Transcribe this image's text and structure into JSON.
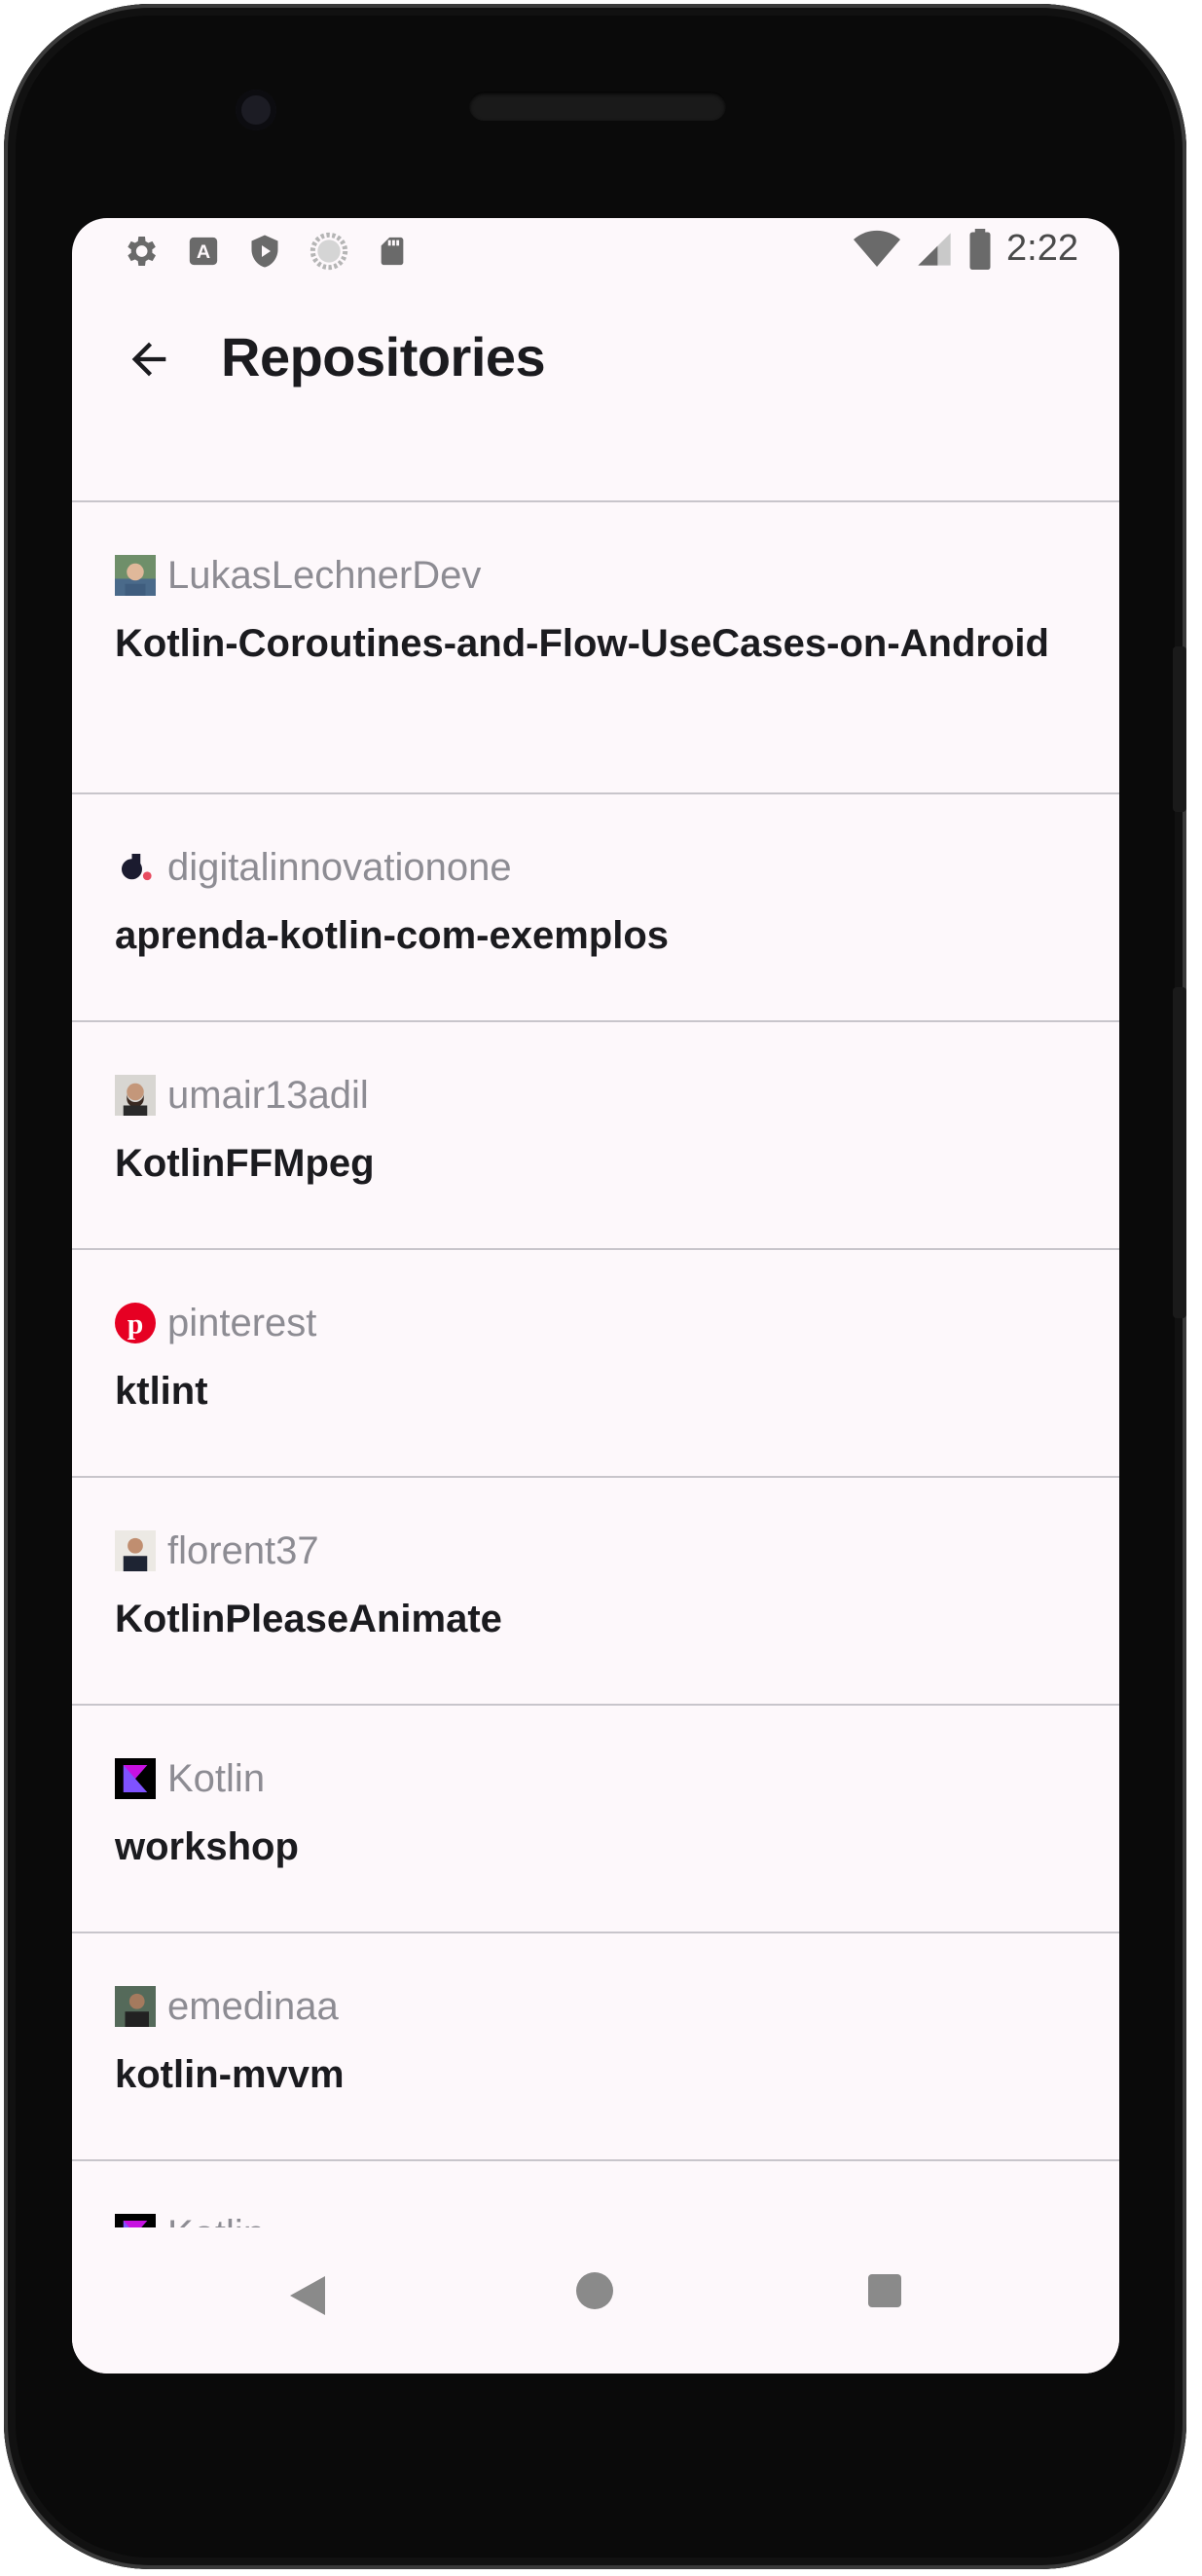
{
  "status_bar": {
    "time": "2:22",
    "left_icons": [
      "settings-icon",
      "a-badge-icon",
      "shield-play-icon",
      "loading-circle-icon",
      "sd-card-icon"
    ],
    "right_icons": [
      "wifi-icon",
      "signal-icon",
      "battery-icon"
    ]
  },
  "app_bar": {
    "title": "Repositories",
    "back_icon": "arrow-back-icon"
  },
  "repositories": [
    {
      "owner": "LukasLechnerDev",
      "name": "Kotlin-Coroutines-and-Flow-UseCases-on-Android",
      "avatar": "photo-avatar"
    },
    {
      "owner": "digitalinnovationone",
      "name": "aprenda-kotlin-com-exemplos",
      "avatar": "dio-logo"
    },
    {
      "owner": "umair13adil",
      "name": "KotlinFFMpeg",
      "avatar": "photo-avatar"
    },
    {
      "owner": "pinterest",
      "name": "ktlint",
      "avatar": "pinterest-logo"
    },
    {
      "owner": "florent37",
      "name": "KotlinPleaseAnimate",
      "avatar": "photo-avatar"
    },
    {
      "owner": "Kotlin",
      "name": "workshop",
      "avatar": "kotlin-logo"
    },
    {
      "owner": "emedinaa",
      "name": "kotlin-mvvm",
      "avatar": "photo-avatar"
    },
    {
      "owner": "Kotlin",
      "name": "",
      "avatar": "kotlin-logo"
    }
  ],
  "nav_bar": {
    "back_icon": "nav-back-icon",
    "home_icon": "nav-home-icon",
    "recents_icon": "nav-recents-icon"
  },
  "colors": {
    "background": "#fdf8fb",
    "title": "#1b1b1f",
    "owner_text": "#8d8c93",
    "divider": "#c8c5cb",
    "pinterest_red": "#e60023",
    "kotlin_purple": "#7f52ff"
  }
}
